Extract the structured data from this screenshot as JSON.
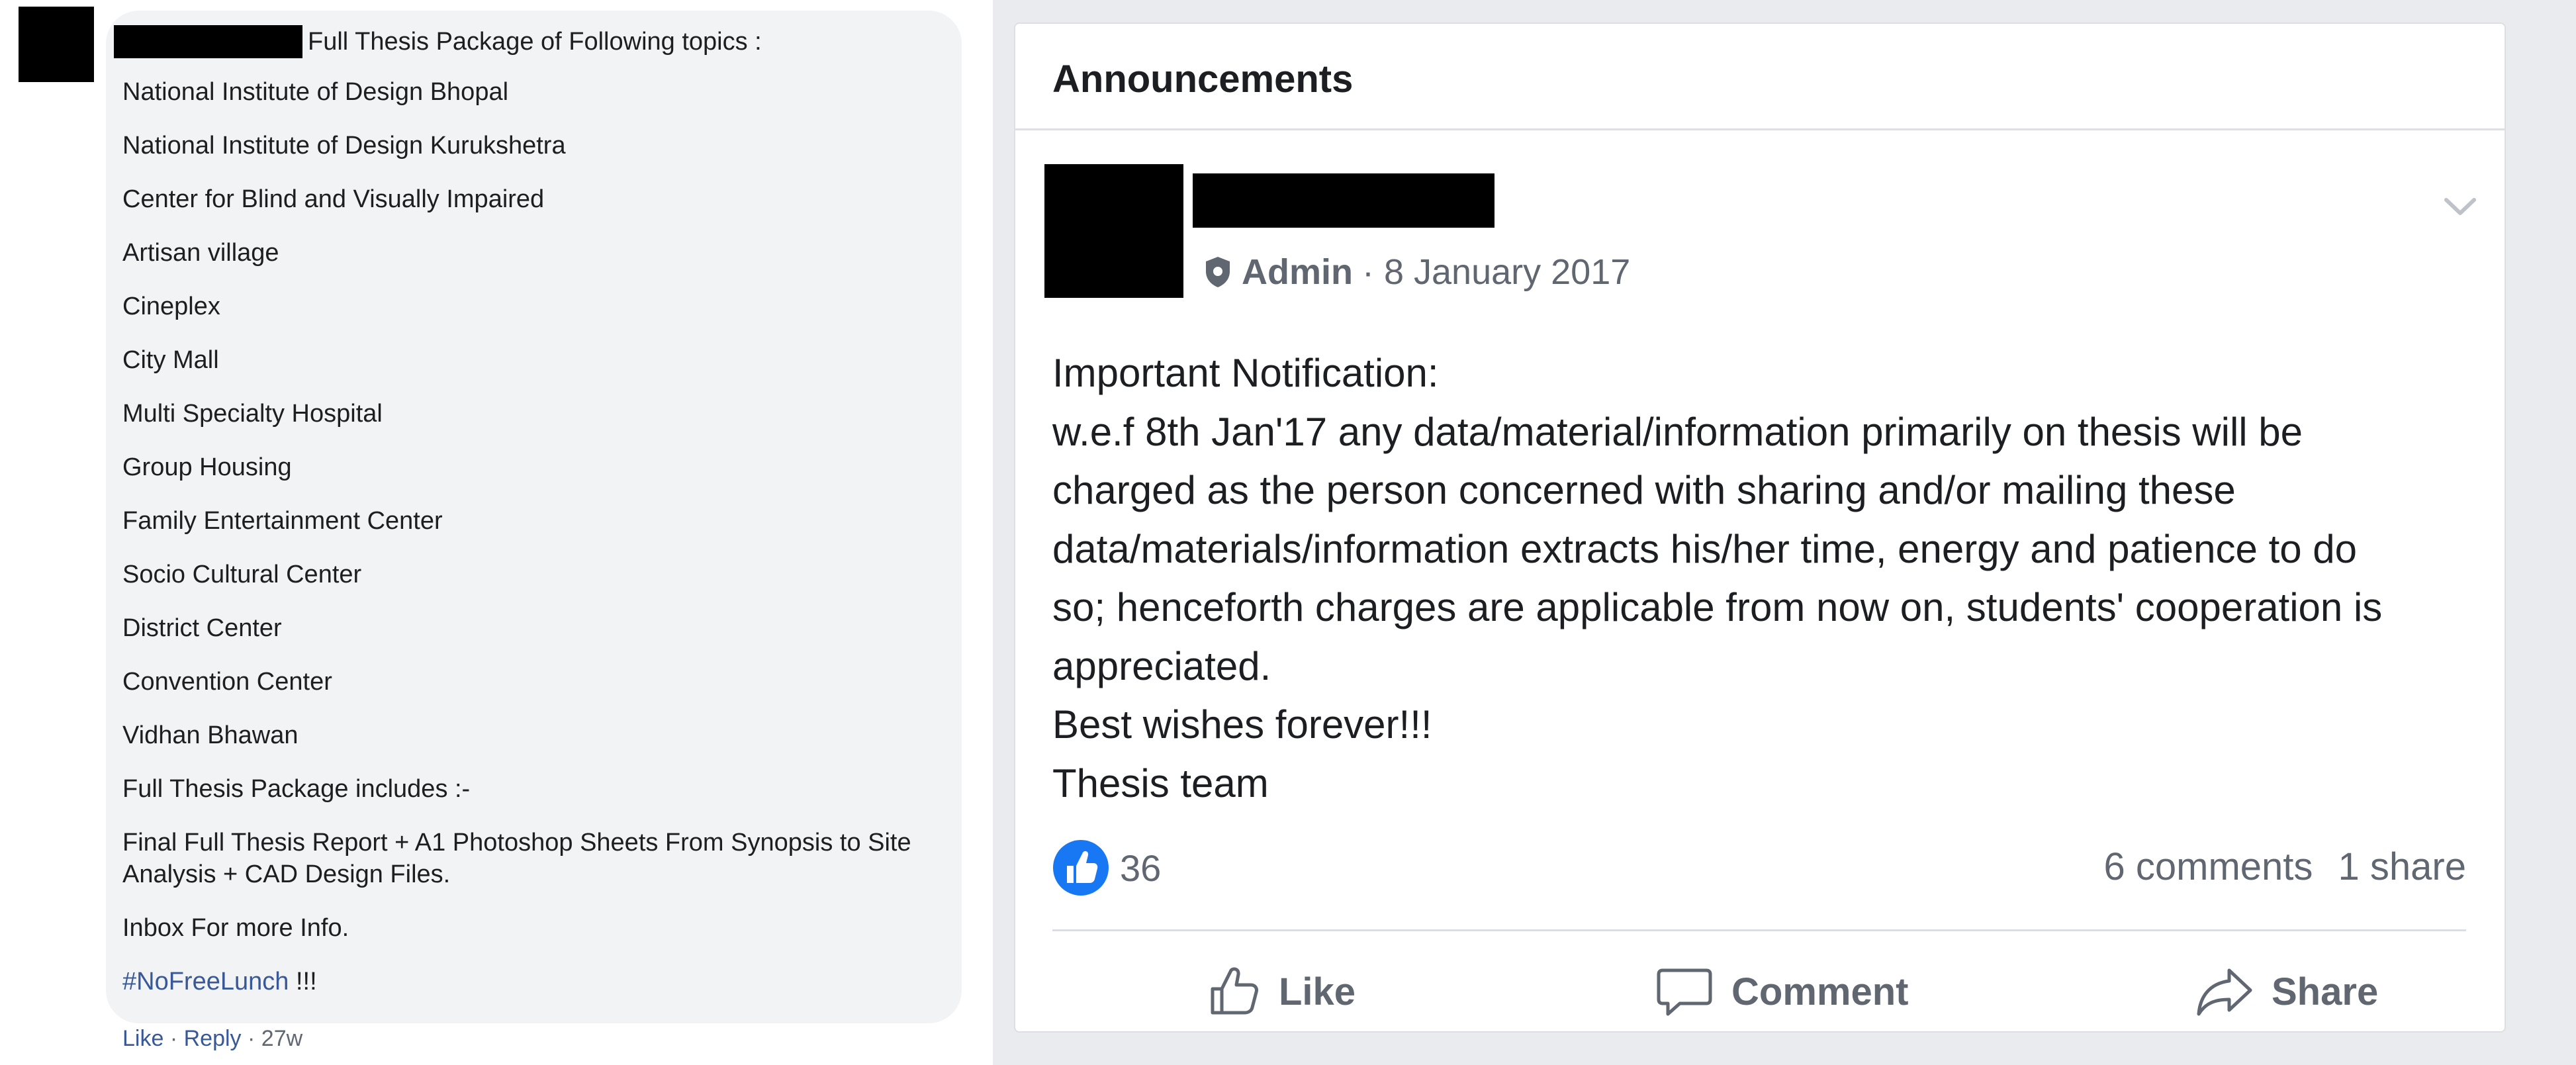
{
  "comment": {
    "header_text": "Full Thesis Package of Following topics :",
    "topics": [
      "National Institute of Design Bhopal",
      "National Institute of Design Kurukshetra",
      "Center for Blind and Visually Impaired",
      "Artisan village",
      "Cineplex",
      "City Mall",
      "Multi Specialty Hospital",
      "Group Housing",
      "Family Entertainment Center",
      "Socio Cultural Center",
      "District Center",
      "Convention Center",
      "Vidhan Bhawan"
    ],
    "includes_heading": "Full Thesis Package includes :-",
    "includes_detail": "Final Full Thesis Report + A1 Photoshop Sheets From Synopsis to Site Analysis + CAD Design Files.",
    "inbox_text": "Inbox For more Info.",
    "hashtag": "#NoFreeLunch",
    "hashtag_suffix": " !!!",
    "actions": {
      "like": "Like",
      "reply": "Reply",
      "separator": "·",
      "age": "27w"
    }
  },
  "announcement": {
    "title": "Announcements",
    "role": "Admin",
    "date_text": "· 8 January 2017",
    "body_lines": [
      "Important Notification:",
      "w.e.f 8th Jan'17 any data/material/information primarily on thesis will be",
      "charged as the person concerned with sharing and/or mailing these",
      "data/materials/information extracts his/her time, energy and patience to do",
      "so; henceforth charges are applicable from now on, students' cooperation is",
      "appreciated.",
      "Best wishes forever!!!",
      "Thesis team"
    ],
    "reaction_count": "36",
    "comments_text": "6 comments",
    "shares_text": "1 share",
    "buttons": {
      "like": "Like",
      "comment": "Comment",
      "share": "Share"
    }
  },
  "colors": {
    "facebook_blue": "#1877f2",
    "link_blue": "#385898",
    "meta_gray": "#606770",
    "panel_bg": "#e9ebee",
    "bubble_bg": "#f2f3f5"
  },
  "icons": [
    "shield-icon",
    "chevron-down-icon",
    "like-reaction-icon",
    "thumbs-up-icon",
    "comment-icon",
    "share-icon"
  ]
}
